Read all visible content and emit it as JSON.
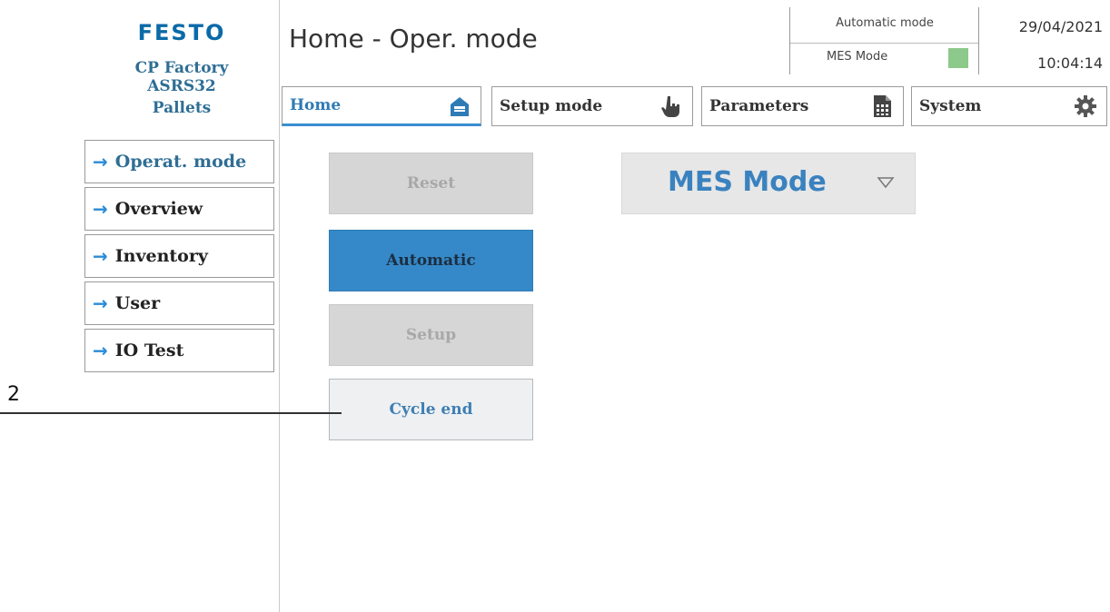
{
  "brand": {
    "logo_text": "FESTO",
    "lines": [
      "CP Factory",
      "ASRS32",
      "Pallets"
    ]
  },
  "header": {
    "title": "Home - Oper. mode",
    "mode_text": "Automatic mode",
    "mes_text": "MES Mode",
    "mes_indicator_color": "#8cc98a",
    "date": "29/04/2021",
    "time": "10:04:14"
  },
  "nav": {
    "items": [
      {
        "label": "Home",
        "icon": "home-icon",
        "active": true
      },
      {
        "label": "Setup mode",
        "icon": "hand-pointer-icon"
      },
      {
        "label": "Parameters",
        "icon": "document-table-icon"
      },
      {
        "label": "System",
        "icon": "gear-icon"
      }
    ]
  },
  "sidebar": {
    "items": [
      {
        "label": "Operat. mode",
        "active": true
      },
      {
        "label": "Overview"
      },
      {
        "label": "Inventory"
      },
      {
        "label": "User"
      },
      {
        "label": "IO Test"
      }
    ]
  },
  "actions": {
    "reset": "Reset",
    "automatic": "Automatic",
    "setup": "Setup",
    "cycle_end": "Cycle end"
  },
  "mode_select": {
    "value": "MES Mode"
  },
  "annotation": {
    "number": "2"
  },
  "colors": {
    "accent": "#3589c8",
    "brand": "#0b6aa8",
    "arrow": "#2a8bd6"
  }
}
